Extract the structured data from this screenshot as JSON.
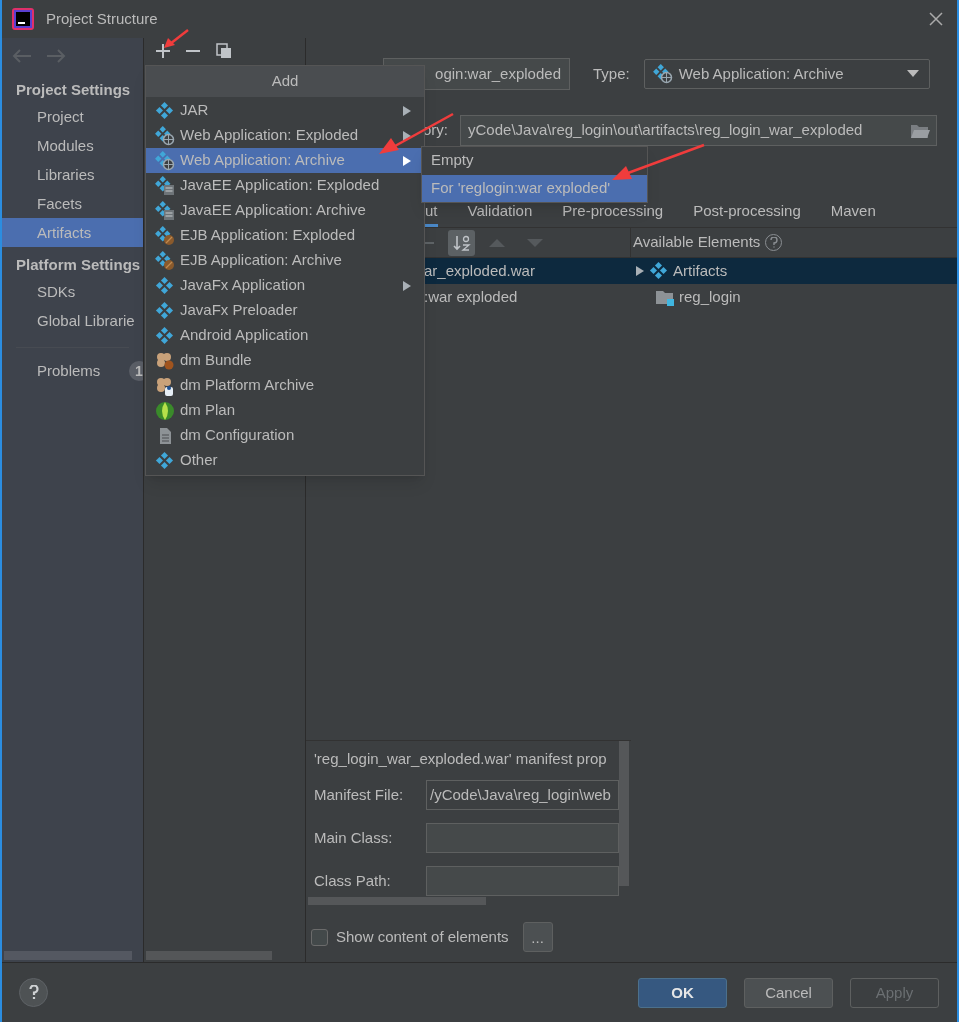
{
  "window": {
    "title": "Project Structure"
  },
  "sidebar": {
    "sections": [
      {
        "title": "Project Settings",
        "items": [
          {
            "label": "Project",
            "selected": false
          },
          {
            "label": "Modules",
            "selected": false
          },
          {
            "label": "Libraries",
            "selected": false
          },
          {
            "label": "Facets",
            "selected": false
          },
          {
            "label": "Artifacts",
            "selected": true
          }
        ]
      },
      {
        "title": "Platform Settings",
        "items": [
          {
            "label": "SDKs",
            "selected": false
          },
          {
            "label": "Global Librarie",
            "selected": false
          }
        ]
      }
    ],
    "problems": {
      "label": "Problems",
      "badge": "1"
    }
  },
  "add_menu": {
    "title": "Add",
    "items": [
      {
        "label": "JAR",
        "kind": "artifact",
        "submenu": true,
        "selected": false
      },
      {
        "label": "Web Application: Exploded",
        "kind": "web",
        "submenu": true,
        "selected": false
      },
      {
        "label": "Web Application: Archive",
        "kind": "web",
        "submenu": true,
        "selected": true
      },
      {
        "label": "JavaEE Application: Exploded",
        "kind": "javaee",
        "submenu": false,
        "selected": false
      },
      {
        "label": "JavaEE Application: Archive",
        "kind": "javaee",
        "submenu": false,
        "selected": false
      },
      {
        "label": "EJB Application: Exploded",
        "kind": "ejb",
        "submenu": false,
        "selected": false
      },
      {
        "label": "EJB Application: Archive",
        "kind": "ejb",
        "submenu": false,
        "selected": false
      },
      {
        "label": "JavaFx Application",
        "kind": "artifact",
        "submenu": true,
        "selected": false
      },
      {
        "label": "JavaFx Preloader",
        "kind": "artifact",
        "submenu": false,
        "selected": false
      },
      {
        "label": "Android Application",
        "kind": "artifact",
        "submenu": false,
        "selected": false
      },
      {
        "label": "dm Bundle",
        "kind": "bundle",
        "submenu": false,
        "selected": false
      },
      {
        "label": "dm Platform Archive",
        "kind": "platform",
        "submenu": false,
        "selected": false
      },
      {
        "label": "dm Plan",
        "kind": "plan",
        "submenu": false,
        "selected": false
      },
      {
        "label": "dm Configuration",
        "kind": "config",
        "submenu": false,
        "selected": false
      },
      {
        "label": "Other",
        "kind": "artifact",
        "submenu": false,
        "selected": false
      }
    ]
  },
  "submenu": {
    "items": [
      {
        "label": "Empty",
        "selected": false
      },
      {
        "label": "For 'reglogin:war exploded'",
        "selected": true
      }
    ]
  },
  "artifact": {
    "name": "ogin:war_exploded",
    "type_label": "Type:",
    "type_value": "Web Application: Archive",
    "output_label": "ory:",
    "output_path": "yCode\\Java\\reg_login\\out\\artifacts\\reg_login_war_exploded"
  },
  "tabs": [
    {
      "label": "ut",
      "selected": true
    },
    {
      "label": "Validation",
      "selected": false
    },
    {
      "label": "Pre-processing",
      "selected": false
    },
    {
      "label": "Post-processing",
      "selected": false
    },
    {
      "label": "Maven",
      "selected": false
    }
  ],
  "layout_tree": [
    {
      "label": "ar_exploded.war",
      "selected": true
    },
    {
      "label": ":war exploded",
      "selected": false
    }
  ],
  "available_elements": {
    "title": "Available Elements",
    "items": [
      {
        "label": "Artifacts",
        "kind": "artifacts",
        "selected": true
      },
      {
        "label": "reg_login",
        "kind": "module",
        "selected": false
      }
    ]
  },
  "manifest": {
    "heading": "'reg_login_war_exploded.war' manifest prop",
    "fields": [
      {
        "label": "Manifest File:",
        "value": "/yCode\\Java\\reg_login\\web"
      },
      {
        "label": "Main Class:"
      },
      {
        "label": "Class Path:"
      }
    ]
  },
  "show_content": {
    "label": "Show content of elements",
    "checked": false,
    "more": "..."
  },
  "buttons": [
    {
      "label": "OK",
      "kind": "primary",
      "disabled": false
    },
    {
      "label": "Cancel",
      "kind": "normal",
      "disabled": false
    },
    {
      "label": "Apply",
      "kind": "normal",
      "disabled": true
    }
  ]
}
